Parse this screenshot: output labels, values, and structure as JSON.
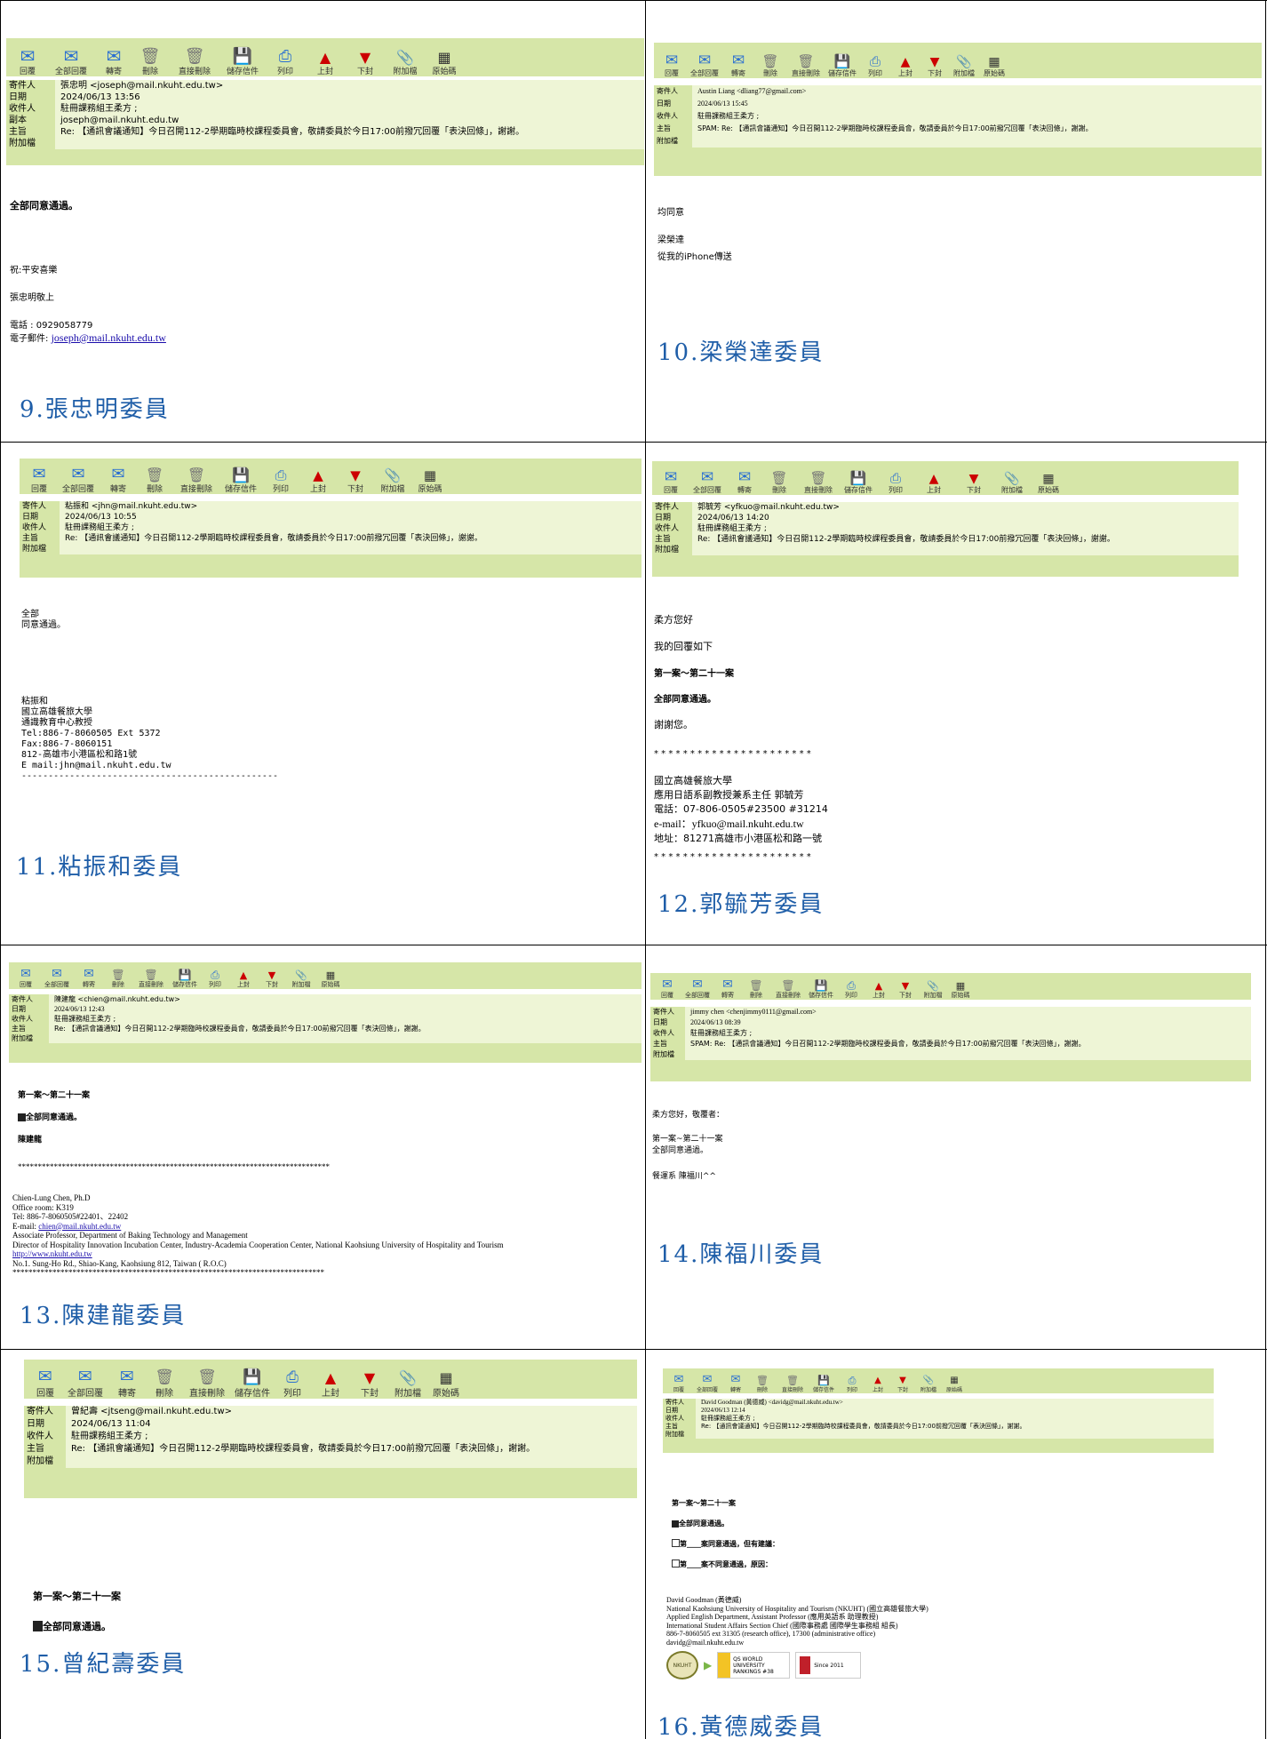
{
  "toolbar": {
    "labels": [
      "回覆",
      "全部回覆",
      "轉寄",
      "刪除",
      "直接刪除",
      "儲存信件",
      "列印",
      "上封",
      "下封",
      "附加檔",
      "原始碼"
    ],
    "icons": [
      "reply-icon",
      "reply-all-icon",
      "forward-icon",
      "delete-icon",
      "direct-delete-icon",
      "save-mail-icon",
      "print-icon",
      "previous-mail-icon",
      "next-mail-icon",
      "attachment-icon",
      "source-code-icon"
    ],
    "glyphs": [
      "✉",
      "✉",
      "✉",
      "🗑",
      "🗑",
      "💾",
      "⎙",
      "▲",
      "▼",
      "📎",
      "▦"
    ],
    "colors": {
      "bar": "#d6e6a8",
      "header": "#eef5d6",
      "arrow": "#cc0000"
    }
  },
  "header_keys": {
    "from": "寄件人",
    "date": "日期",
    "to": "收件人",
    "cc": "副本",
    "subject": "主旨",
    "attach": "附加檔"
  },
  "common": {
    "to": "駐冊課務組王柔方 ;",
    "subject": "Re: 【通訊會議通知】今日召開112-2學期臨時校課程委員會，敬請委員於今日17:00前撥冗回覆「表決回條」，謝謝。",
    "subject_spam": "SPAM: Re: 【通訊會議通知】今日召開112-2學期臨時校課程委員會，敬請委員於今日17:00前撥冗回覆「表決回條」，謝謝。"
  },
  "emails": [
    {
      "from": "張忠明 <joseph@mail.nkuht.edu.tw>",
      "date": "2024/06/13 13:56",
      "cc": "joseph@mail.nkuht.edu.tw",
      "body": [
        "全部同意通過。",
        "祝:平安喜樂",
        "張忠明敬上",
        "電話 : 0929058779"
      ],
      "email_prefix": "電子郵件: ",
      "email_link": "joseph@mail.nkuht.edu.tw",
      "caption": "9.張忠明委員"
    },
    {
      "from": "Austin Liang <dliang77@gmail.com>",
      "date": "2024/06/13 15:45",
      "body": [
        "均同意",
        "梁榮達",
        "從我的iPhone傳送"
      ],
      "caption": "10.梁榮達委員"
    },
    {
      "from": "粘振和 <jhn@mail.nkuht.edu.tw>",
      "date": "2024/06/13 10:55",
      "body": [
        "全部",
        "同意通過。",
        "粘振和",
        "國立高雄餐旅大學",
        "通識教育中心教授",
        "Tel:886-7-8060505 Ext 5372",
        "Fax:886-7-8060151",
        "812-高雄市小港區松和路1號",
        "E mail:jhn@mail.nkuht.edu.tw",
        "------------------------------------------------"
      ],
      "caption": "11.粘振和委員"
    },
    {
      "from": "郭毓芳 <yfkuo@mail.nkuht.edu.tw>",
      "date": "2024/06/13 14:20",
      "body": [
        "柔方您好",
        "我的回覆如下",
        "第一案～第二十一案",
        "全部同意通過。",
        "謝謝您。",
        "* * * * * * * * * * * * * * * * * * * * * *",
        "國立高雄餐旅大學",
        "應用日語系副教授兼系主任 郭毓芳",
        "電話：07-806-0505#23500 #31214",
        "e-mail：yfkuo@mail.nkuht.edu.tw",
        "地址：81271高雄市小港區松和路一號",
        "* * * * * * * * * * * * * * * * * * * * * *"
      ],
      "caption": "12.郭毓芳委員"
    },
    {
      "from": "陳建龍 <chien@mail.nkuht.edu.tw>",
      "date": "2024/06/13 12:43",
      "body": [
        "第一案～第二十一案",
        "全部同意通過。",
        "陳建龍",
        "******************************************************************************",
        "Chien-Lung Chen, Ph.D",
        "Office room: K319",
        "Tel: 886-7-8060505#22401、22402"
      ],
      "email_prefix": "E-mail: ",
      "email_link": "chien@mail.nkuht.edu.tw",
      "body2": [
        "Associate Professor, Department  of Baking Technology and Management",
        "Director of Hospitality Innovation Incubation Center, Industry-Academia Cooperation Center, National Kaohsiung University of Hospitality and Tourism"
      ],
      "web_link": "http://www.nkuht.edu.tw",
      "body3": [
        "No.1. Sung-Ho Rd., Shiao-Kang, Kaohsiung 812, Taiwan ( R.O.C)",
        "******************************************************************************"
      ],
      "caption": "13.陳建龍委員"
    },
    {
      "from": "jimmy chen <chenjimmy0111@gmail.com>",
      "date": "2024/06/13 08:39",
      "body": [
        "柔方您好，敬覆者：",
        "第一案~第二十一案",
        "全部同意通過。",
        "餐運系 陳福川^^"
      ],
      "caption": "14.陳福川委員"
    },
    {
      "from": "曾紀壽 <jtseng@mail.nkuht.edu.tw>",
      "date": "2024/06/13 11:04",
      "body": [
        "第一案～第二十一案",
        "全部同意通過。"
      ],
      "caption": "15.曾紀壽委員"
    },
    {
      "from": "David Goodman (黃德威) <davidg@mail.nkuht.edu.tw>",
      "date": "2024/06/13 12:14",
      "body": [
        "第一案～第二十一案",
        "全部同意通過。",
        "第____案同意通過，但有建議：",
        "第____案不同意通過，原因：",
        "David Goodman (黃德威)",
        "National Kaohsiung University of Hospitality and Tourism (NKUHT) (國立高雄餐旅大學)",
        "Applied English Department, Assistant Professor (應用英語系 助理教授)",
        "International Student Affairs Section Chief (國際事務處 國際學生事務組 組長)",
        "886-7-8060505 ext 31305 (research office), 17300 (administrative office)",
        "davidg@mail.nkuht.edu.tw"
      ],
      "logos": [
        "NKUHT",
        "QS WORLD UNIVERSITY RANKINGS #38",
        "Since 2011"
      ],
      "caption": "16.黃德威委員"
    }
  ]
}
